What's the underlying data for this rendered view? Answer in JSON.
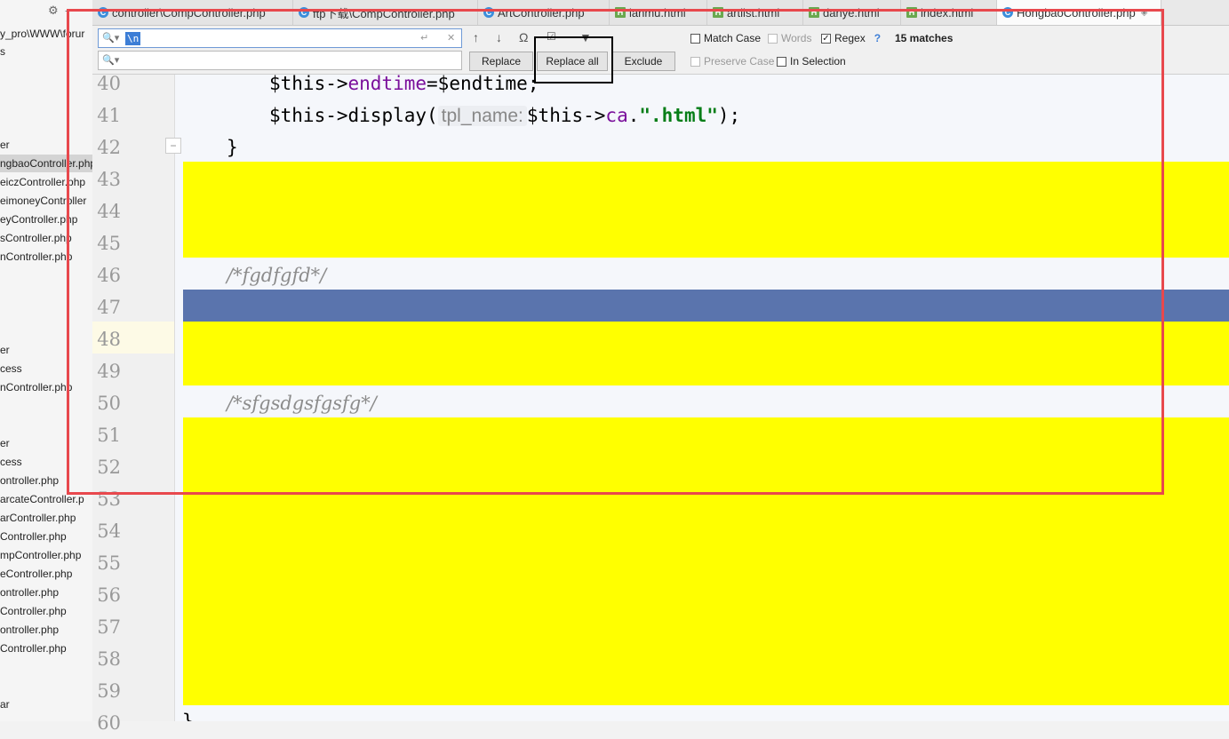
{
  "sidebar": {
    "path": "y_pro\\WWW\\forur",
    "items": [
      {
        "label": "s"
      },
      {
        "label": "er"
      },
      {
        "label": "ngbaoController.php",
        "selected": true
      },
      {
        "label": "eiczController.php"
      },
      {
        "label": "eimoneyController"
      },
      {
        "label": "eyController.php"
      },
      {
        "label": "sController.php"
      },
      {
        "label": "nController.php"
      },
      {
        "label": "er"
      },
      {
        "label": "cess"
      },
      {
        "label": "nController.php"
      },
      {
        "label": "er"
      },
      {
        "label": "cess"
      },
      {
        "label": "ontroller.php"
      },
      {
        "label": "arcateController.p"
      },
      {
        "label": "arController.php"
      },
      {
        "label": "Controller.php"
      },
      {
        "label": "mpController.php"
      },
      {
        "label": "eController.php"
      },
      {
        "label": "ontroller.php"
      },
      {
        "label": "Controller.php"
      },
      {
        "label": "ontroller.php"
      },
      {
        "label": "Controller.php"
      },
      {
        "label": "ar"
      }
    ]
  },
  "tabs": [
    {
      "label": "controller\\CompController.php",
      "icon": "php-class-icon"
    },
    {
      "label": "ftp下载\\CompController.php",
      "icon": "php-class-icon"
    },
    {
      "label": "ArtController.php",
      "icon": "php-class-icon"
    },
    {
      "label": "lanmu.html",
      "icon": "html-file-icon"
    },
    {
      "label": "artlist.html",
      "icon": "html-file-icon"
    },
    {
      "label": "danye.html",
      "icon": "html-file-icon"
    },
    {
      "label": "index.html",
      "icon": "html-file-icon"
    },
    {
      "label": "HongbaoController.php",
      "icon": "php-class-icon",
      "active": true
    }
  ],
  "find": {
    "search_value": "\\n",
    "replace_value": "",
    "buttons": {
      "replace": "Replace",
      "replace_all": "Replace all",
      "exclude": "Exclude"
    },
    "options": {
      "match_case": {
        "label": "Match Case",
        "checked": false
      },
      "words": {
        "label": "Words",
        "checked": false,
        "disabled": true
      },
      "regex": {
        "label": "Regex",
        "checked": true
      },
      "regex_help": "?",
      "preserve_case": {
        "label": "Preserve Case",
        "checked": false,
        "disabled": true
      },
      "in_selection": {
        "label": "In Selection",
        "checked": false
      }
    },
    "match_count": "15 matches"
  },
  "editor": {
    "line_numbers": [
      "40",
      "41",
      "42",
      "43",
      "44",
      "45",
      "46",
      "47",
      "48",
      "49",
      "50",
      "51",
      "52",
      "53",
      "54",
      "55",
      "56",
      "57",
      "58",
      "59",
      "60"
    ],
    "lines": {
      "l40": {
        "this": "$this->",
        "prop": "endtime",
        "rest": "=$endtime;"
      },
      "l41": {
        "this": "$this->",
        "call": "display(",
        "hint": "tpl_name:",
        "arg_this": "$this->",
        "arg_prop": "ca",
        "dot": ".",
        "str": "\".html\"",
        "end": ");"
      },
      "l42": {
        "text": "}"
      },
      "l46": {
        "text": "/*fgdfgfd*/"
      },
      "l50": {
        "text": "/*sfgsdgsfgsfg*/"
      },
      "l60": {
        "text": "}"
      }
    },
    "colors": {
      "match_highlight": "#ffff00",
      "current_match": "#5a74ad",
      "caret_row": "#fdfae6"
    }
  }
}
